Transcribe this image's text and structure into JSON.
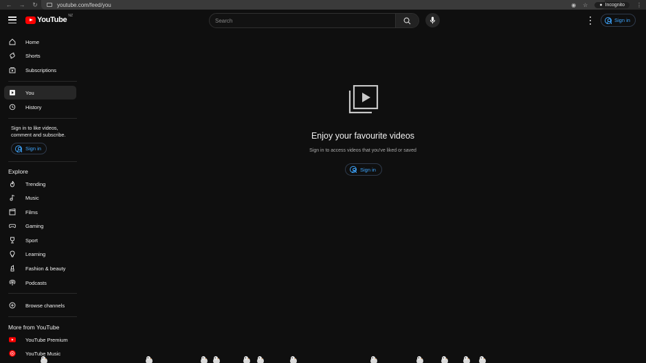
{
  "browser": {
    "url": "youtube.com/feed/you",
    "profile_label": "Incognito"
  },
  "masthead": {
    "logo_text": "YouTube",
    "country_code": "NZ",
    "search_placeholder": "Search",
    "signin_label": "Sign in"
  },
  "sidebar": {
    "primary": [
      {
        "label": "Home",
        "icon": "home-icon"
      },
      {
        "label": "Shorts",
        "icon": "shorts-icon"
      },
      {
        "label": "Subscriptions",
        "icon": "subscriptions-icon"
      }
    ],
    "you": [
      {
        "label": "You",
        "icon": "you-icon"
      },
      {
        "label": "History",
        "icon": "history-icon"
      }
    ],
    "promo_text": "Sign in to like videos, comment and subscribe.",
    "signin_label": "Sign in",
    "explore_heading": "Explore",
    "explore": [
      {
        "label": "Trending",
        "icon": "trending-icon"
      },
      {
        "label": "Music",
        "icon": "music-icon"
      },
      {
        "label": "Films",
        "icon": "films-icon"
      },
      {
        "label": "Gaming",
        "icon": "gaming-icon"
      },
      {
        "label": "Sport",
        "icon": "sport-icon"
      },
      {
        "label": "Learning",
        "icon": "learning-icon"
      },
      {
        "label": "Fashion & beauty",
        "icon": "fashion-icon"
      },
      {
        "label": "Podcasts",
        "icon": "podcasts-icon"
      }
    ],
    "browse_channels": "Browse channels",
    "more_heading": "More from YouTube",
    "more": [
      {
        "label": "YouTube Premium",
        "icon": "youtube-premium-icon"
      },
      {
        "label": "YouTube Music",
        "icon": "youtube-music-icon"
      }
    ]
  },
  "main": {
    "title": "Enjoy your favourite videos",
    "subtitle": "Sign in to access videos that you've liked or saved",
    "signin_label": "Sign in"
  },
  "colors": {
    "background": "#0f0f0f",
    "accent_blue": "#3ea6ff",
    "brand_red": "#ff0000"
  }
}
